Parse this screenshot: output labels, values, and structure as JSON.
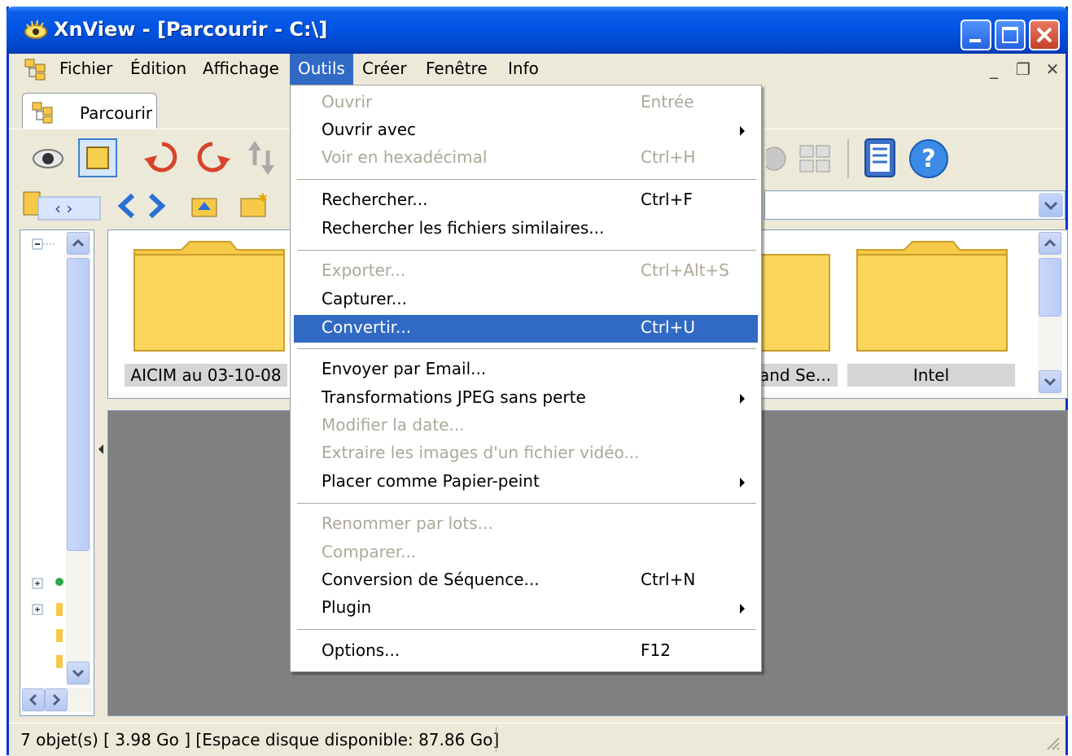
{
  "window": {
    "title": "XnView - [Parcourir - C:\\]"
  },
  "menubar": {
    "items": [
      "Fichier",
      "Édition",
      "Affichage",
      "Outils",
      "Créer",
      "Fenêtre",
      "Info"
    ],
    "active": "Outils"
  },
  "tabs": [
    {
      "label": "Parcourir"
    }
  ],
  "thumbnails": [
    {
      "label": "AICIM au 03-10-08"
    },
    {
      "label": "and Se..."
    },
    {
      "label": "Intel"
    }
  ],
  "status": {
    "text": "7 objet(s) [ 3.98 Go ] [Espace disque disponible: 87.86 Go]"
  },
  "outils_menu": {
    "items": [
      {
        "label": "Ouvrir",
        "shortcut": "Entrée",
        "disabled": true
      },
      {
        "label": "Ouvrir avec",
        "submenu": true
      },
      {
        "label": "Voir en hexadécimal",
        "shortcut": "Ctrl+H",
        "disabled": true
      },
      {
        "label": "Rechercher...",
        "shortcut": "Ctrl+F"
      },
      {
        "label": "Rechercher les fichiers similaires..."
      },
      {
        "label": "Exporter...",
        "shortcut": "Ctrl+Alt+S",
        "disabled": true
      },
      {
        "label": "Capturer..."
      },
      {
        "label": "Convertir...",
        "shortcut": "Ctrl+U",
        "highlighted": true
      },
      {
        "label": "Envoyer par Email..."
      },
      {
        "label": "Transformations JPEG sans perte",
        "submenu": true
      },
      {
        "label": "Modifier la date...",
        "disabled": true
      },
      {
        "label": "Extraire les images d'un fichier vidéo...",
        "disabled": true
      },
      {
        "label": "Placer comme Papier-peint",
        "submenu": true
      },
      {
        "label": "Renommer par lots...",
        "disabled": true
      },
      {
        "label": "Comparer...",
        "disabled": true
      },
      {
        "label": "Conversion de Séquence...",
        "shortcut": "Ctrl+N"
      },
      {
        "label": "Plugin",
        "submenu": true
      },
      {
        "label": "Options...",
        "shortcut": "F12"
      }
    ]
  },
  "colors": {
    "highlight": "#316ac5",
    "titlebar": "#0054e3",
    "disabled_text": "#aca899",
    "preview_bg": "#808080"
  }
}
